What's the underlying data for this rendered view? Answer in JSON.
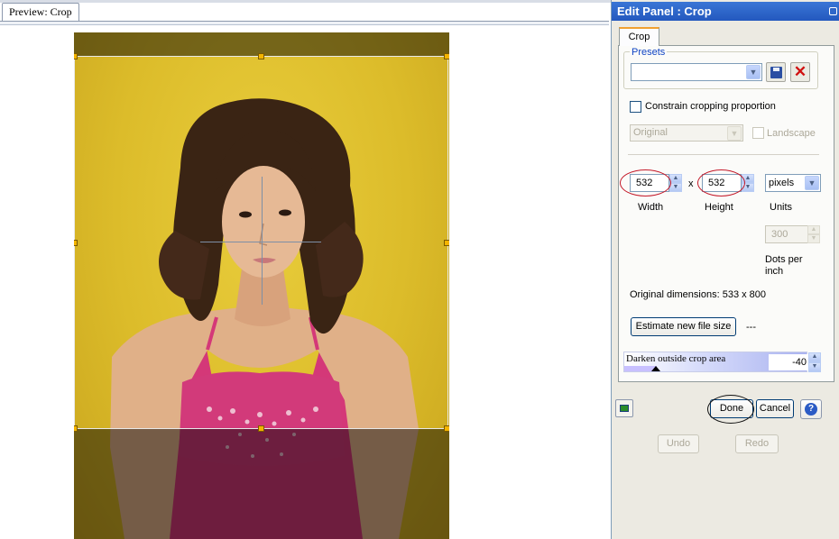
{
  "preview": {
    "tab_label": "Preview: Crop"
  },
  "panel": {
    "title": "Edit Panel : Crop",
    "tab_label": "Crop",
    "presets": {
      "label": "Presets",
      "selected": ""
    },
    "constrain_label": "Constrain cropping proportion",
    "constrain_checked": false,
    "ratio_selected": "Original",
    "landscape_label": "Landscape",
    "landscape_checked": false,
    "width_value": "532",
    "height_value": "532",
    "size_separator": "x",
    "width_label": "Width",
    "height_label": "Height",
    "units_label": "Units",
    "units_selected": "pixels",
    "dpi_value": "300",
    "dpi_label_line1": "Dots per",
    "dpi_label_line2": "inch",
    "original_dimensions": "Original dimensions: 533 x 800",
    "estimate_button": "Estimate new file size",
    "estimate_result": "---",
    "darken_label": "Darken outside crop area",
    "darken_value": "-40",
    "done_button": "Done",
    "cancel_button": "Cancel",
    "help_button": "?",
    "undo_button": "Undo",
    "redo_button": "Redo"
  },
  "colors": {
    "title_bar": "#2358be",
    "panel_bg": "#eceae2",
    "crop_handle": "#f3b400",
    "highlight_ring": "#c41a2a"
  }
}
